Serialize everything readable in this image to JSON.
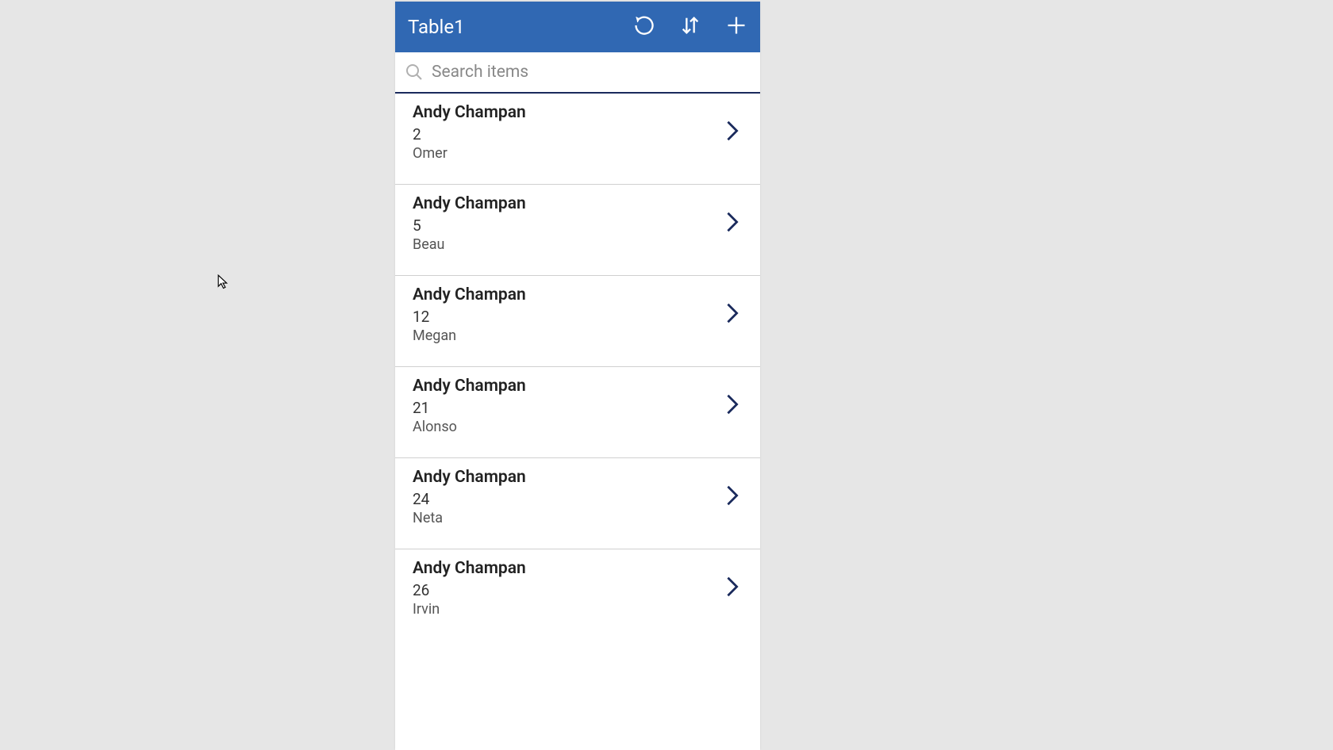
{
  "header": {
    "title": "Table1"
  },
  "search": {
    "placeholder": "Search items",
    "value": ""
  },
  "items": [
    {
      "title": "Andy Champan",
      "number": "2",
      "subtitle": "Omer"
    },
    {
      "title": "Andy Champan",
      "number": "5",
      "subtitle": "Beau"
    },
    {
      "title": "Andy Champan",
      "number": "12",
      "subtitle": "Megan"
    },
    {
      "title": "Andy Champan",
      "number": "21",
      "subtitle": "Alonso"
    },
    {
      "title": "Andy Champan",
      "number": "24",
      "subtitle": "Neta"
    },
    {
      "title": "Andy Champan",
      "number": "26",
      "subtitle": "Irvin"
    }
  ],
  "colors": {
    "headerBg": "#3068b3",
    "chevron": "#1a2a5c"
  }
}
